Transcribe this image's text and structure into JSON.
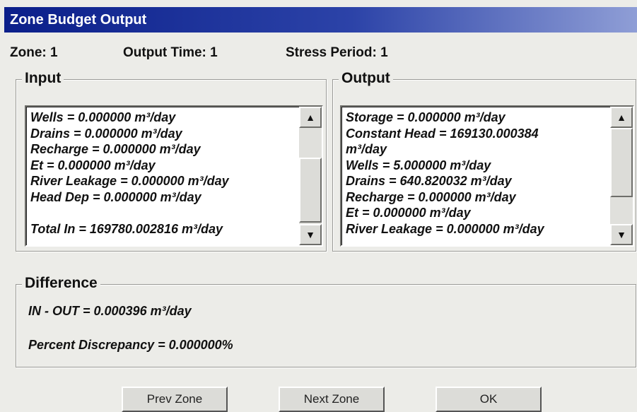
{
  "window": {
    "title": "Zone Budget Output"
  },
  "info": {
    "zone": "Zone: 1",
    "output_time": "Output Time: 1",
    "stress_period": "Stress Period: 1"
  },
  "input": {
    "title": "Input",
    "lines": [
      "Wells = 0.000000 m³/day",
      "Drains = 0.000000 m³/day",
      "Recharge = 0.000000 m³/day",
      "Et = 0.000000 m³/day",
      "River Leakage = 0.000000 m³/day",
      "Head Dep = 0.000000 m³/day",
      "",
      "Total In = 169780.002816 m³/day"
    ]
  },
  "output": {
    "title": "Output",
    "lines": [
      "Storage = 0.000000 m³/day",
      "Constant Head = 169130.000384",
      "m³/day",
      "Wells = 5.000000 m³/day",
      "Drains = 640.820032 m³/day",
      "Recharge = 0.000000 m³/day",
      "Et = 0.000000 m³/day",
      "River Leakage = 0.000000 m³/day"
    ]
  },
  "difference": {
    "title": "Difference",
    "in_out": "IN - OUT = 0.000396 m³/day",
    "percent": "Percent Discrepancy = 0.000000%"
  },
  "buttons": {
    "prev_zone": "Prev Zone",
    "next_zone": "Next Zone",
    "ok": "OK"
  },
  "icons": {
    "scroll_up": "up-arrow-icon",
    "scroll_down": "down-arrow-icon"
  }
}
